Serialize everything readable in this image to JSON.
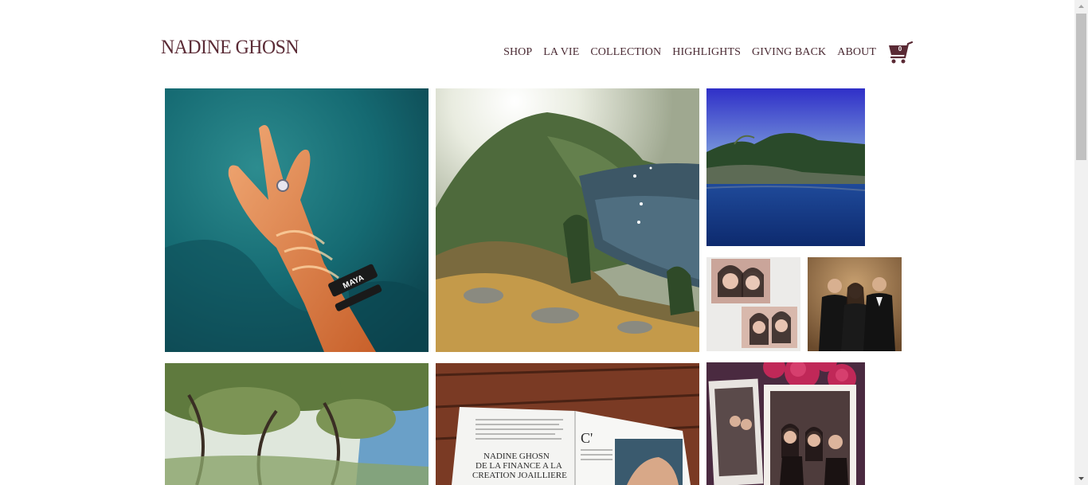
{
  "brand": {
    "name": "NADINE GHOSN",
    "color": "#5a2a35"
  },
  "nav": {
    "items": [
      {
        "label": "SHOP"
      },
      {
        "label": "LA VIE"
      },
      {
        "label": "COLLECTION"
      },
      {
        "label": "HIGHLIGHTS"
      },
      {
        "label": "GIVING BACK"
      },
      {
        "label": "ABOUT"
      }
    ]
  },
  "cart": {
    "count": "0",
    "icon": "cart-icon"
  },
  "gallery": {
    "magazine_text": {
      "initial": "C'",
      "line1": "NADINE GHOSN",
      "line2": "DE LA FINANCE A LA",
      "line3": "CREATION JOAILLIERE"
    },
    "bracelet_text": "MAYA"
  }
}
